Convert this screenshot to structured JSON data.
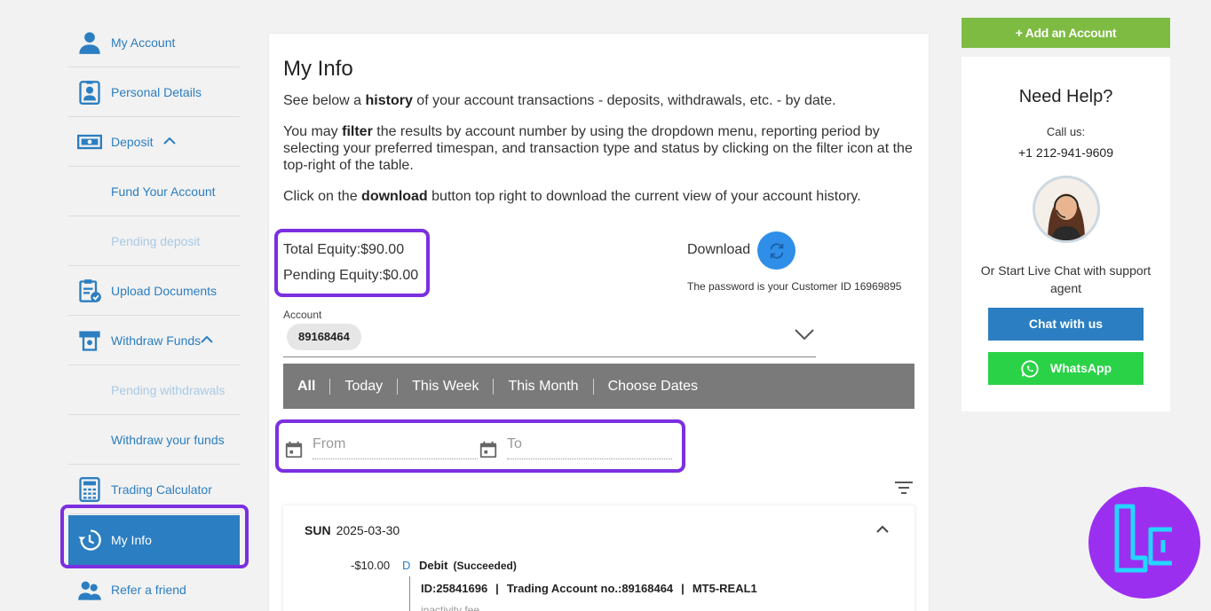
{
  "sidebar": {
    "items": [
      {
        "label": "My Account",
        "icon": "user-icon"
      },
      {
        "label": "Personal Details",
        "icon": "id-card-icon"
      },
      {
        "label": "Deposit",
        "icon": "cash-icon"
      },
      {
        "label": "Fund Your Account"
      },
      {
        "label": "Pending deposit"
      },
      {
        "label": "Upload Documents",
        "icon": "document-check-icon"
      },
      {
        "label": "Withdraw Funds",
        "icon": "atm-icon"
      },
      {
        "label": "Pending withdrawals"
      },
      {
        "label": "Withdraw your funds"
      },
      {
        "label": "Trading Calculator",
        "icon": "calculator-icon"
      },
      {
        "label": "My Info",
        "icon": "history-icon"
      },
      {
        "label": "Refer a friend",
        "icon": "users-icon"
      }
    ]
  },
  "main": {
    "title": "My Info",
    "para1_pre": "See below a ",
    "para1_bold": "history",
    "para1_post": " of your account transactions - deposits, withdrawals, etc. - by date.",
    "para2_pre": "You may ",
    "para2_bold": "filter",
    "para2_post": " the results by account number by using the dropdown menu, reporting period by selecting your preferred timespan, and transaction type and status by clicking on the filter icon at the top-right of the table.",
    "para3_pre": "Click on the ",
    "para3_bold": "download",
    "para3_post": " button top right to download the current view of your account history.",
    "total_equity": "Total Equity:$90.00",
    "pending_equity": "Pending Equity:$0.00",
    "download_label": "Download",
    "password_note": "The password is your Customer ID 16969895",
    "account_label": "Account",
    "account_value": "89168464",
    "periods": [
      "All",
      "Today",
      "This Week",
      "This Month",
      "Choose Dates"
    ],
    "from_placeholder": "From",
    "to_placeholder": "To",
    "transaction": {
      "day": "SUN",
      "date": "2025-03-30",
      "amount": "-$10.00",
      "type_code": "D",
      "title": "Debit",
      "status": "(Succeeded)",
      "id": "ID:25841696",
      "account": "Trading Account no.:89168464",
      "server": "MT5-REAL1",
      "note": "inactivity fee"
    }
  },
  "right": {
    "add_account": "+ Add an Account",
    "help_title": "Need Help?",
    "call_us": "Call us:",
    "phone": "+1 212-941-9609",
    "live_chat": "Or Start Live Chat with support agent",
    "chat_button": "Chat with us",
    "whatsapp_button": "WhatsApp"
  },
  "colors": {
    "primary": "#2b7ec1",
    "highlight": "#7b2fe0",
    "add_green": "#7dbb42",
    "whatsapp_green": "#2ad247",
    "period_bar": "#7a7a7a"
  }
}
